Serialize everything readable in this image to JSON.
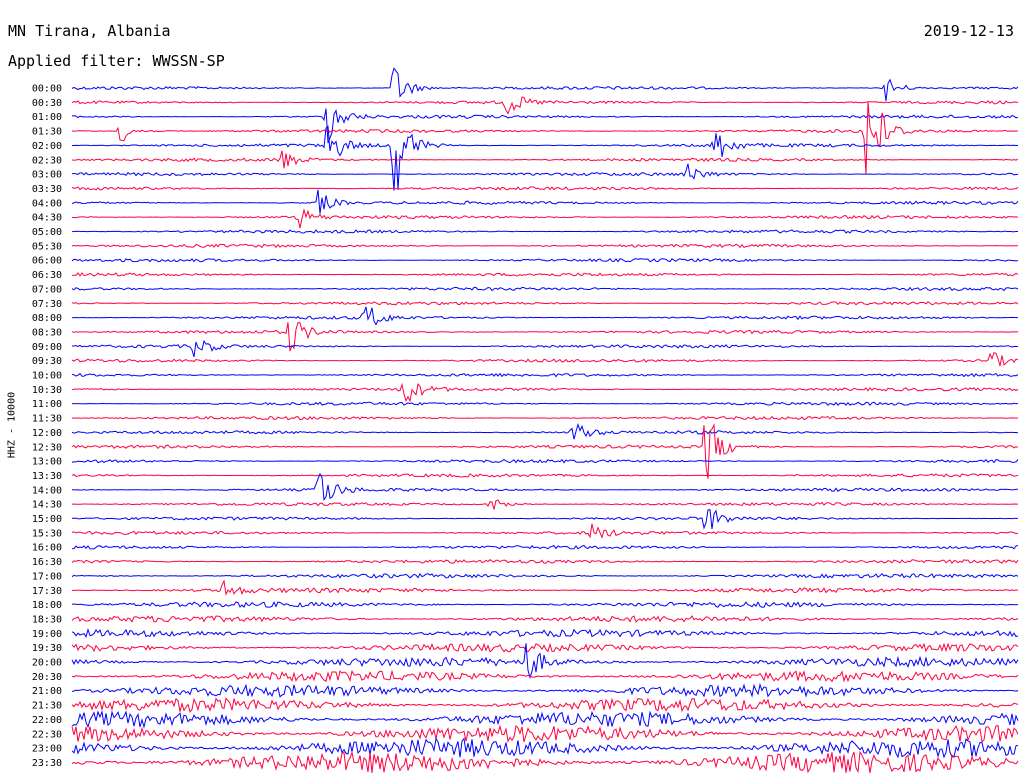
{
  "header": {
    "station": "MN Tirana, Albania",
    "filter": "Applied filter: WWSSN-SP",
    "date": "2019-12-13"
  },
  "chart_data": {
    "type": "line",
    "title": "MN Tirana, Albania",
    "subtitle": "Applied filter: WWSSN-SP",
    "date": "2019-12-13",
    "ylabel": "HHZ - 10000",
    "rows": [
      "00:00",
      "00:30",
      "01:00",
      "01:30",
      "02:00",
      "02:30",
      "03:00",
      "03:30",
      "04:00",
      "04:30",
      "05:00",
      "05:30",
      "06:00",
      "06:30",
      "07:00",
      "07:30",
      "08:00",
      "08:30",
      "09:00",
      "09:30",
      "10:00",
      "10:30",
      "11:00",
      "11:30",
      "12:00",
      "12:30",
      "13:00",
      "13:30",
      "14:00",
      "14:30",
      "15:00",
      "15:30",
      "16:00",
      "16:30",
      "17:00",
      "17:30",
      "18:00",
      "18:30",
      "19:00",
      "19:30",
      "20:00",
      "20:30",
      "21:00",
      "21:30",
      "22:00",
      "22:30",
      "23:00",
      "23:30"
    ],
    "colors": [
      "#0000ff",
      "#ff0040"
    ],
    "events": [
      {
        "row": 0,
        "x_fraction": 0.34,
        "amplitude": 1.9
      },
      {
        "row": 0,
        "x_fraction": 0.86,
        "amplitude": 1.0
      },
      {
        "row": 1,
        "x_fraction": 0.46,
        "amplitude": 1.0
      },
      {
        "row": 2,
        "x_fraction": 0.27,
        "amplitude": 2.0
      },
      {
        "row": 3,
        "x_fraction": 0.05,
        "amplitude": 1.0
      },
      {
        "row": 3,
        "x_fraction": 0.84,
        "amplitude": 5.0
      },
      {
        "row": 4,
        "x_fraction": 0.27,
        "amplitude": 1.9
      },
      {
        "row": 4,
        "x_fraction": 0.34,
        "amplitude": 4.5
      },
      {
        "row": 4,
        "x_fraction": 0.68,
        "amplitude": 1.5
      },
      {
        "row": 5,
        "x_fraction": 0.22,
        "amplitude": 0.9
      },
      {
        "row": 6,
        "x_fraction": 0.65,
        "amplitude": 0.8
      },
      {
        "row": 8,
        "x_fraction": 0.26,
        "amplitude": 1.0
      },
      {
        "row": 9,
        "x_fraction": 0.24,
        "amplitude": 0.8
      },
      {
        "row": 16,
        "x_fraction": 0.31,
        "amplitude": 1.2
      },
      {
        "row": 17,
        "x_fraction": 0.23,
        "amplitude": 1.6
      },
      {
        "row": 18,
        "x_fraction": 0.13,
        "amplitude": 0.9
      },
      {
        "row": 19,
        "x_fraction": 0.97,
        "amplitude": 0.8
      },
      {
        "row": 21,
        "x_fraction": 0.35,
        "amplitude": 1.4
      },
      {
        "row": 24,
        "x_fraction": 0.53,
        "amplitude": 1.0
      },
      {
        "row": 25,
        "x_fraction": 0.67,
        "amplitude": 3.0
      },
      {
        "row": 28,
        "x_fraction": 0.26,
        "amplitude": 2.0
      },
      {
        "row": 29,
        "x_fraction": 0.44,
        "amplitude": 0.7
      },
      {
        "row": 30,
        "x_fraction": 0.67,
        "amplitude": 1.2
      },
      {
        "row": 31,
        "x_fraction": 0.55,
        "amplitude": 0.7
      },
      {
        "row": 35,
        "x_fraction": 0.16,
        "amplitude": 0.7
      },
      {
        "row": 40,
        "x_fraction": 0.48,
        "amplitude": 1.5
      }
    ]
  }
}
